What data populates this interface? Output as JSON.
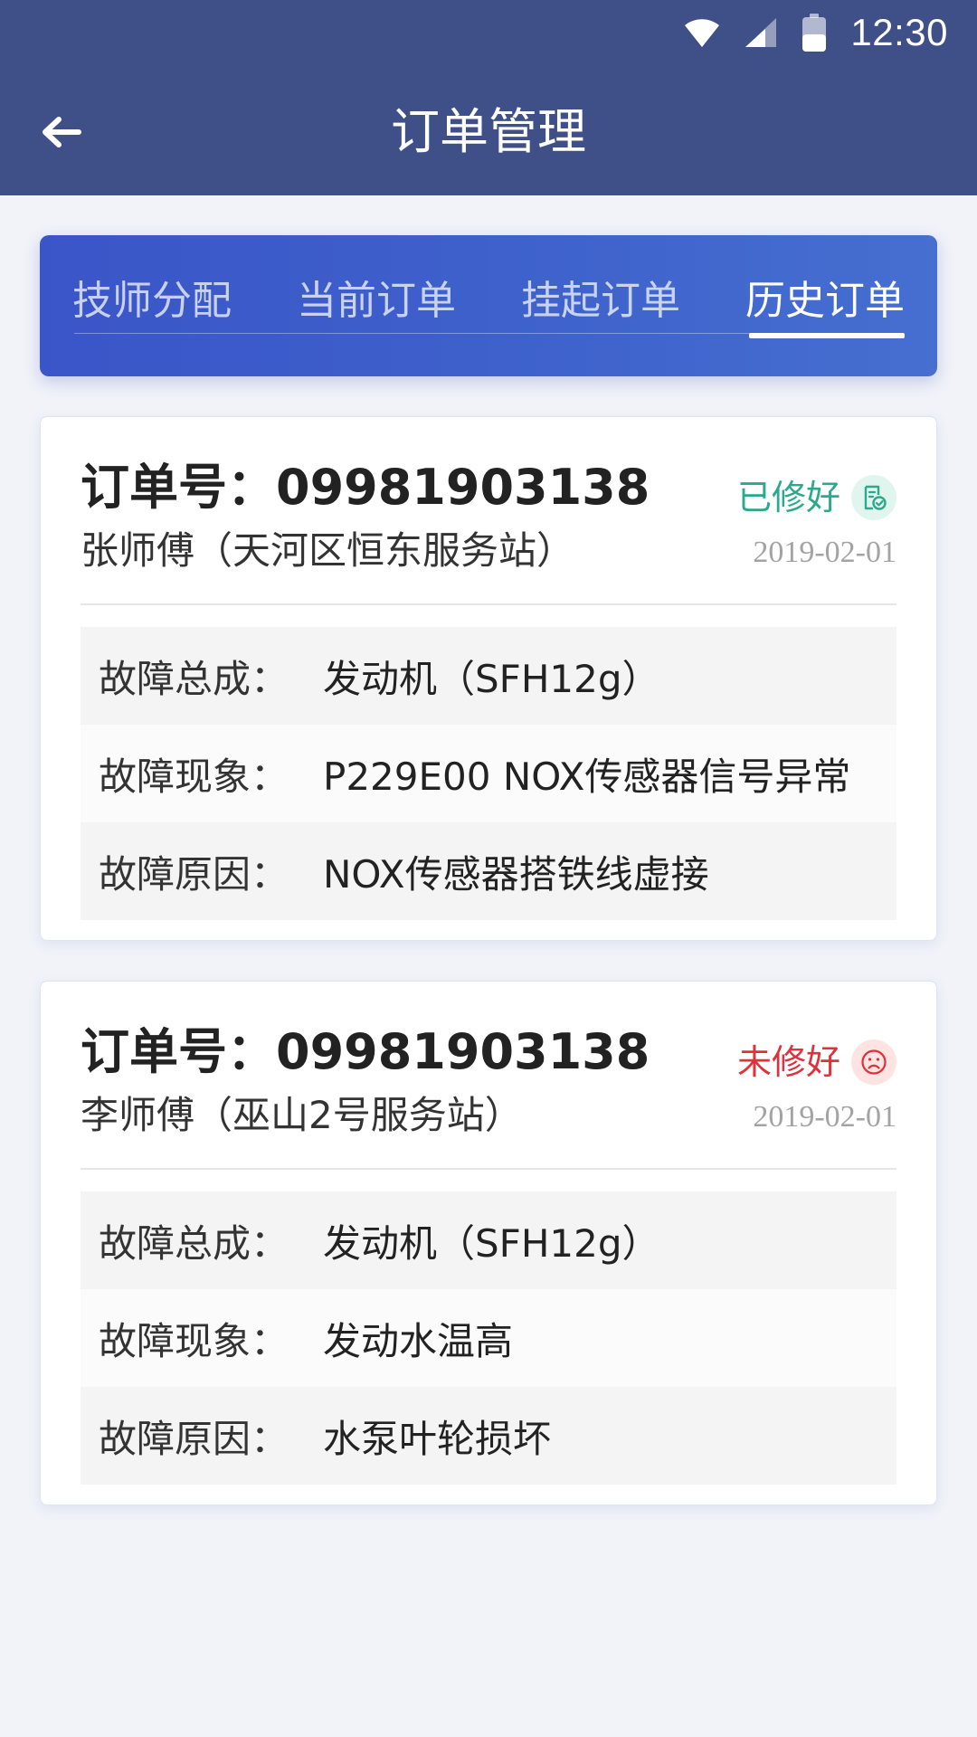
{
  "status_bar": {
    "time": "12:30",
    "icons": [
      "wifi-icon",
      "signal-icon",
      "battery-icon"
    ]
  },
  "header": {
    "back_icon": "arrow-left-icon",
    "title": "订单管理"
  },
  "tabs": [
    {
      "label": "技师分配",
      "active": false
    },
    {
      "label": "当前订单",
      "active": false
    },
    {
      "label": "挂起订单",
      "active": false
    },
    {
      "label": "历史订单",
      "active": true
    }
  ],
  "orders": [
    {
      "order_number": "订单号：09981903138",
      "technician": "张师傅（天河区恒东服务站）",
      "status": "已修好",
      "status_icon": "document-check-icon",
      "status_color": "#2aa98d",
      "date": "2019-02-01",
      "faults": [
        {
          "label": "故障总成：",
          "value": "发动机（SFH12g）"
        },
        {
          "label": "故障现象：",
          "value": "P229E00 NOX传感器信号异常"
        },
        {
          "label": "故障原因：",
          "value": "NOX传感器搭铁线虚接"
        }
      ]
    },
    {
      "order_number": "订单号：09981903138",
      "technician": "李师傅（巫山2号服务站）",
      "status": "未修好",
      "status_icon": "sad-face-icon",
      "status_color": "#e0303c",
      "date": "2019-02-01",
      "faults": [
        {
          "label": "故障总成：",
          "value": "发动机（SFH12g）"
        },
        {
          "label": "故障现象：",
          "value": "发动水温高"
        },
        {
          "label": "故障原因：",
          "value": "水泵叶轮损坏"
        }
      ]
    }
  ],
  "colors": {
    "header_bg": "#3f4f88",
    "tabs_bg": "#3f63cc",
    "page_bg": "#f1f3f9"
  }
}
